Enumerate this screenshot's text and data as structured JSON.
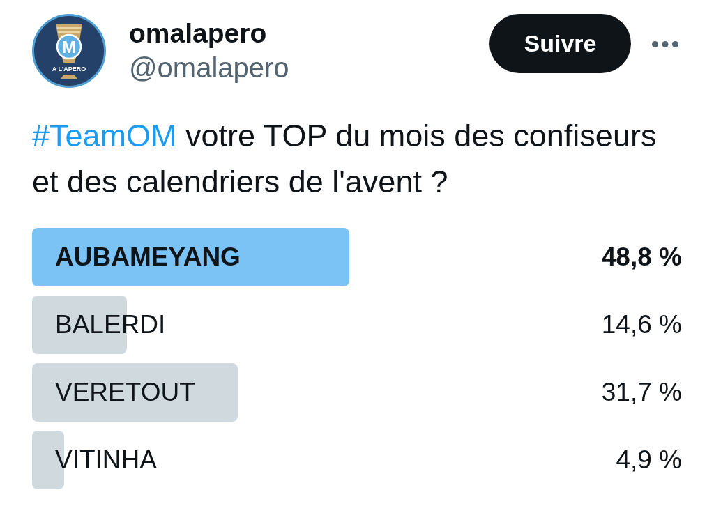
{
  "author": {
    "name": "omalapero",
    "handle": "@omalapero",
    "avatar": {
      "monogram": "M",
      "caption": "A L'APERO"
    }
  },
  "follow_button": "Suivre",
  "tweet": {
    "hashtag": "#TeamOM",
    "text": "votre TOP du mois des confiseurs et des calendriers de l'avent ?"
  },
  "poll": {
    "options": [
      {
        "label": "AUBAMEYANG",
        "percent": "48,8 %",
        "level": 0.488,
        "winner": true
      },
      {
        "label": "BALERDI",
        "percent": "14,6 %",
        "level": 0.146,
        "winner": false
      },
      {
        "label": "VERETOUT",
        "percent": "31,7 %",
        "level": 0.317,
        "winner": false
      },
      {
        "label": "VITINHA",
        "percent": "4,9 %",
        "level": 0.049,
        "winner": false
      }
    ]
  }
}
